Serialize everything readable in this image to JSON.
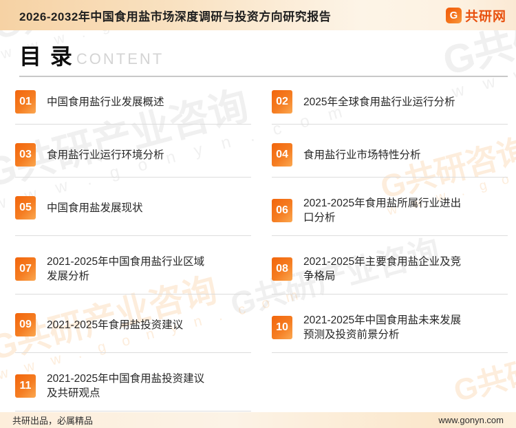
{
  "header": {
    "title": "2026-2032年中国食用盐市场深度调研与投资方向研究报告",
    "logo_icon": "G",
    "logo_text": "共研网"
  },
  "toc": {
    "heading": "目 录",
    "heading_en": "CONTENT",
    "items": [
      {
        "num": "01",
        "title": "中国食用盐行业发展概述"
      },
      {
        "num": "02",
        "title": "2025年全球食用盐行业运行分析"
      },
      {
        "num": "03",
        "title": "食用盐行业运行环境分析"
      },
      {
        "num": "04",
        "title": "食用盐行业市场特性分析"
      },
      {
        "num": "05",
        "title": "中国食用盐发展现状"
      },
      {
        "num": "06",
        "title": "2021-2025年食用盐所属行业进出\n口分析"
      },
      {
        "num": "07",
        "title": "2021-2025年中国食用盐行业区域\n发展分析"
      },
      {
        "num": "08",
        "title": "2021-2025年主要食用盐企业及竞\n争格局"
      },
      {
        "num": "09",
        "title": "2021-2025年食用盐投资建议"
      },
      {
        "num": "10",
        "title": "2021-2025年中国食用盐未来发展\n预测及投资前景分析"
      },
      {
        "num": "11",
        "title": "2021-2025年中国食用盐投资建议\n及共研观点"
      }
    ]
  },
  "footer": {
    "left": "共研出品，必属精品",
    "right": "www.gonyn.com"
  },
  "watermarks": {
    "brand": "G共研产业咨询",
    "brand_short": "G共研咨询",
    "url_spaced": "w w w . g o n y n . c o m"
  },
  "colors": {
    "accent": "#f2650c",
    "header_band": "#f6d2a4",
    "logo_red": "#e8500e"
  }
}
